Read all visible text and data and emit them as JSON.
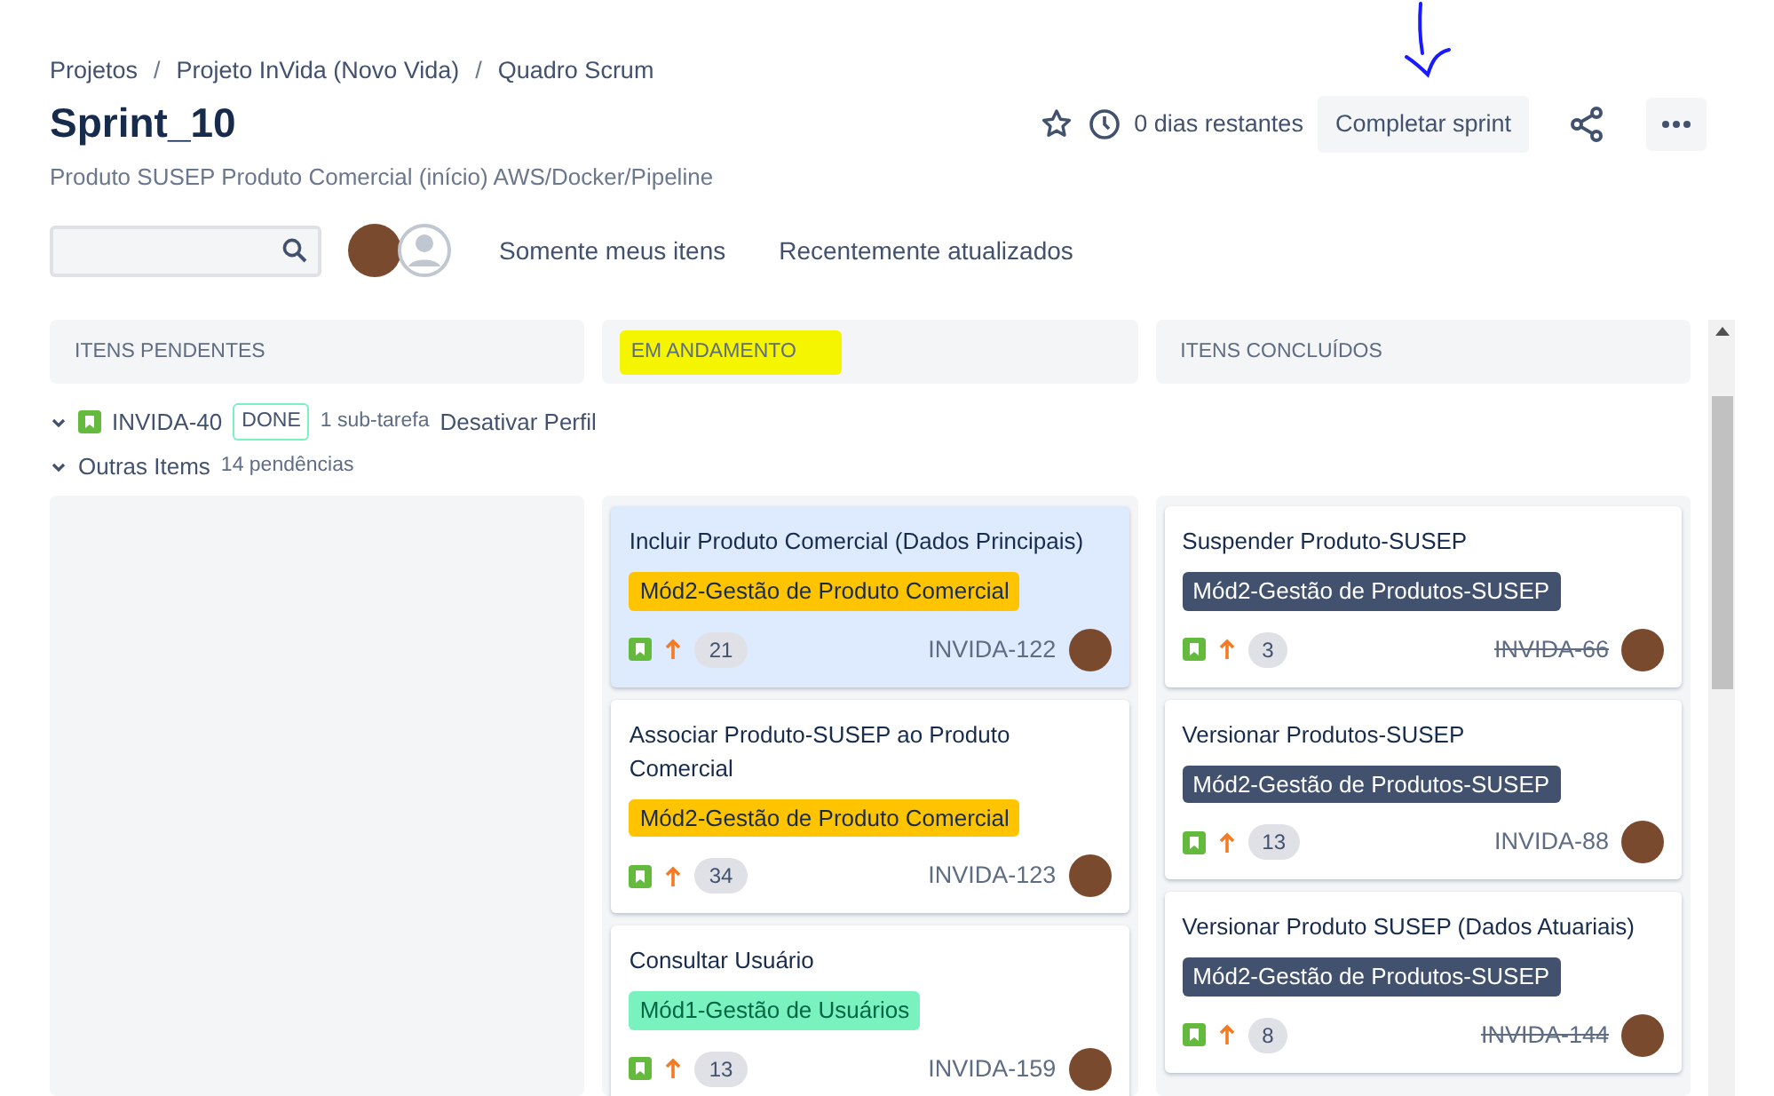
{
  "breadcrumbs": [
    {
      "kind": "link",
      "text": "Projetos"
    },
    {
      "kind": "separator",
      "text": "/"
    },
    {
      "kind": "link",
      "text": "Projeto InVida (Novo Vida)"
    },
    {
      "kind": "separator",
      "text": "/"
    },
    {
      "kind": "link",
      "text": "Quadro Scrum"
    }
  ],
  "title": "Sprint_10",
  "subtitle": "Produto SUSEP Produto Comercial (início) AWS/Docker/Pipeline",
  "header_actions": {
    "starred": false,
    "days_remaining": "0 dias restantes",
    "complete_button": "Completar sprint"
  },
  "filters": [
    "Somente meus itens",
    "Recentemente atualizados"
  ],
  "columns": [
    {
      "title": "ITENS PENDENTES",
      "highlighted": false
    },
    {
      "title": "EM ANDAMENTO",
      "highlighted": true,
      "cards": [
        {
          "title": "Incluir Produto Comercial (Dados Principais)",
          "label": {
            "text": "Mód2-Gestão de Produto Comercial",
            "color": "#ffc400"
          },
          "points": "21",
          "key": "INVIDA-122",
          "done": false,
          "selected": true
        },
        {
          "title": "Associar Produto-SUSEP ao Produto Comercial",
          "label": {
            "text": "Mód2-Gestão de Produto Comercial",
            "color": "#ffc400"
          },
          "points": "34",
          "key": "INVIDA-123",
          "done": false,
          "selected": false
        },
        {
          "title": "Consultar Usuário",
          "label": {
            "text": "Mód1-Gestão de Usuários",
            "color": "#79f2c0"
          },
          "points": "13",
          "key": "INVIDA-159",
          "done": false,
          "selected": false
        }
      ]
    },
    {
      "title": "ITENS CONCLUÍDOS",
      "highlighted": false,
      "cards": [
        {
          "title": "Suspender Produto-SUSEP",
          "label": {
            "text": "Mód2-Gestão de Produtos-SUSEP",
            "color": "#42526e"
          },
          "points": "3",
          "key": "INVIDA-66",
          "done": true,
          "selected": false
        },
        {
          "title": "Versionar Produtos-SUSEP",
          "label": {
            "text": "Mód2-Gestão de Produtos-SUSEP",
            "color": "#42526e"
          },
          "points": "13",
          "key": "INVIDA-88",
          "done": false,
          "selected": false
        },
        {
          "title": "Versionar Produto SUSEP (Dados Atuariais)",
          "label": {
            "text": "Mód2-Gestão de Produtos-SUSEP",
            "color": "#42526e"
          },
          "points": "8",
          "key": "INVIDA-144",
          "done": true,
          "selected": false
        }
      ]
    }
  ],
  "swimlanes": [
    {
      "kind": "issue",
      "expanded": true,
      "key": "INVIDA-40",
      "status": "DONE",
      "subtasks": "1 sub-tarefa",
      "summary": "Desativar Perfil"
    },
    {
      "kind": "group",
      "expanded": true,
      "title": "Outras Items",
      "count": "14 pendências"
    }
  ]
}
